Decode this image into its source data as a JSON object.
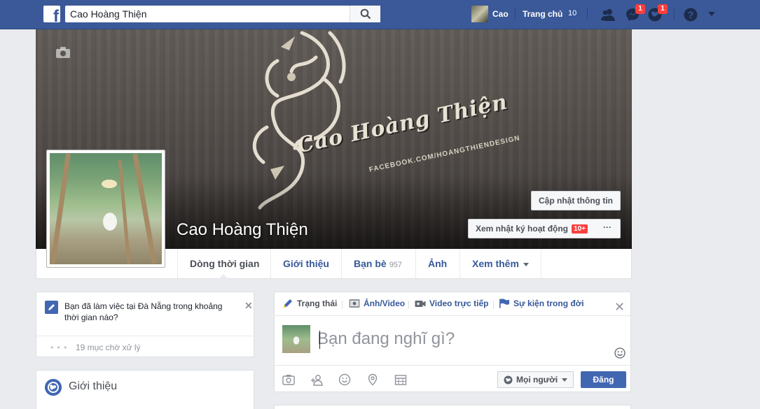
{
  "topbar": {
    "logo": "f",
    "search_value": "Cao Hoàng Thiện",
    "user_name": "Cao",
    "home_label": "Trang chủ",
    "home_count": "10",
    "messages_badge": "1",
    "notifications_badge": "1",
    "icons": [
      "friend-requests-icon",
      "messages-icon",
      "notifications-icon",
      "help-icon",
      "account-menu-icon"
    ]
  },
  "cover": {
    "brand_title": "Cao Hoàng Thiện",
    "brand_url": "FACEBOOK.COM/HOANGTHIENDESIGN",
    "profile_name": "Cao Hoàng Thiện",
    "update_info_label": "Cập nhật thông tin",
    "activity_log_label": "Xem nhật ký hoạt động",
    "activity_count": "10+",
    "more_label": "···"
  },
  "nav": {
    "tabs": [
      {
        "label": "Dòng thời gian"
      },
      {
        "label": "Giới thiệu"
      },
      {
        "label": "Bạn bè",
        "count": "957"
      },
      {
        "label": "Ảnh"
      },
      {
        "label": "Xem thêm"
      }
    ]
  },
  "prompt_card": {
    "text": "Bạn đã làm việc tại Đà Nẵng trong khoảng thời gian nào?",
    "close": "✕",
    "dots": "• • •",
    "pending": "19 mục chờ xử lý"
  },
  "intro_card": {
    "title": "Giới thiệu"
  },
  "composer": {
    "tabs": [
      {
        "label": "Trạng thái"
      },
      {
        "label": "Ảnh/Video"
      },
      {
        "label": "Video trực tiếp"
      },
      {
        "label": "Sự kiện trong đời"
      }
    ],
    "close": "✕",
    "placeholder": "Bạn đang nghĩ gì?",
    "audience": "Mọi người",
    "post_label": "Đăng"
  },
  "colors": {
    "brand_blue": "#3b5998",
    "button_blue": "#4267b2",
    "link_blue": "#365899",
    "badge_red": "#fa3e3e",
    "page_bg": "#e9ebee"
  }
}
